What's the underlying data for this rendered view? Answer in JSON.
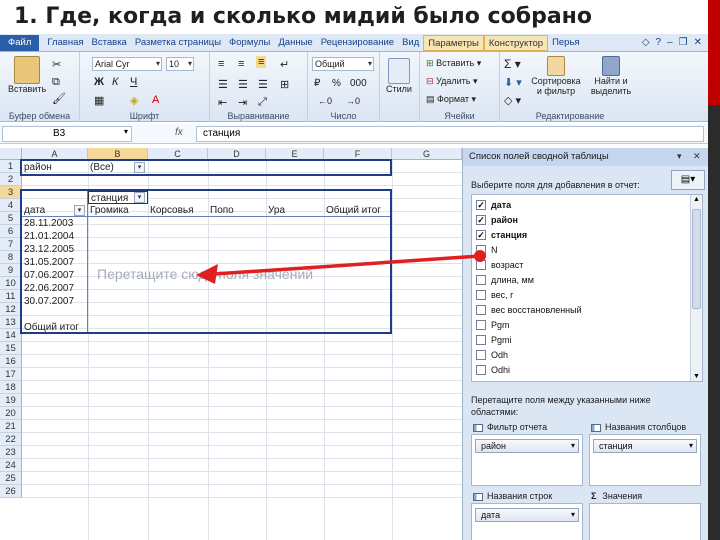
{
  "slide": {
    "title": "1. Где, когда и сколько мидий было собрано"
  },
  "ribbon": {
    "tabs": [
      "Файл",
      "Главная",
      "Вставка",
      "Разметка страницы",
      "Формулы",
      "Данные",
      "Рецензирование",
      "Вид",
      "Параметры",
      "Конструктор",
      "Перья"
    ],
    "groups": {
      "clipboard": {
        "label": "Буфер обмена",
        "paste": "Вставить"
      },
      "font": {
        "label": "Шрифт",
        "name": "Arial Cyr",
        "size": "10"
      },
      "alignment": {
        "label": "Выравнивание"
      },
      "number": {
        "label": "Число",
        "format": "Общий"
      },
      "styles": {
        "label": "",
        "button": "Стили"
      },
      "cells": {
        "label": "Ячейки",
        "insert": "Вставить",
        "delete": "Удалить",
        "format": "Формат"
      },
      "editing": {
        "label": "Редактирование",
        "sort": "Сортировка и фильтр",
        "find": "Найти и выделить"
      }
    }
  },
  "formula_bar": {
    "cell_ref": "B3",
    "fx": "fx",
    "value": "станция"
  },
  "sheet": {
    "columns": [
      "A",
      "B",
      "C",
      "D",
      "E",
      "F",
      "G"
    ],
    "rows": [
      "1",
      "2",
      "3",
      "4",
      "5",
      "6",
      "7",
      "8",
      "9",
      "10",
      "11",
      "12",
      "13",
      "14",
      "15",
      "16",
      "17",
      "18",
      "19",
      "20",
      "21",
      "22",
      "23",
      "24",
      "25",
      "26"
    ],
    "pivot": {
      "filter_label": "район",
      "filter_value": "(Все)",
      "col_field": "станция",
      "row_field": "дата",
      "col_items": [
        "Громика",
        "Корсовья",
        "Попо",
        "Ура",
        "Общий итог"
      ],
      "row_items": [
        "28.11.2003",
        "21.01.2004",
        "23.12.2005",
        "31.05.2007",
        "07.06.2007",
        "22.06.2007",
        "30.07.2007"
      ],
      "grand_total": "Общий итог",
      "drop_hint": "Перетащите сюда поля значений"
    }
  },
  "pane": {
    "title": "Список полей сводной таблицы",
    "choose_text": "Выберите поля для добавления в отчет:",
    "fields": [
      {
        "name": "дата",
        "checked": true
      },
      {
        "name": "район",
        "checked": true
      },
      {
        "name": "станция",
        "checked": true
      },
      {
        "name": "N",
        "checked": false
      },
      {
        "name": "возраст",
        "checked": false
      },
      {
        "name": "длина, мм",
        "checked": false
      },
      {
        "name": "вес, г",
        "checked": false
      },
      {
        "name": "вес восстановленный",
        "checked": false
      },
      {
        "name": "Pgm",
        "checked": false
      },
      {
        "name": "Pgmi",
        "checked": false
      },
      {
        "name": "Odh",
        "checked": false
      },
      {
        "name": "Odhi",
        "checked": false
      }
    ],
    "drag_text_1": "Перетащите поля между указанными ниже",
    "drag_text_2": "областями:",
    "areas": {
      "report_filter": {
        "label": "Фильтр отчета",
        "chip": "район"
      },
      "column_labels": {
        "label": "Названия столбцов",
        "chip": "станция"
      },
      "row_labels": {
        "label": "Названия строк",
        "chip": "дата"
      },
      "values": {
        "label": "Значения",
        "sigma": "Σ"
      }
    }
  },
  "colors": {
    "accent": "#1f3c88",
    "arrow": "#e02020",
    "ribbon_tab": "#2a5ea8",
    "slide_accent": "#c00000"
  }
}
